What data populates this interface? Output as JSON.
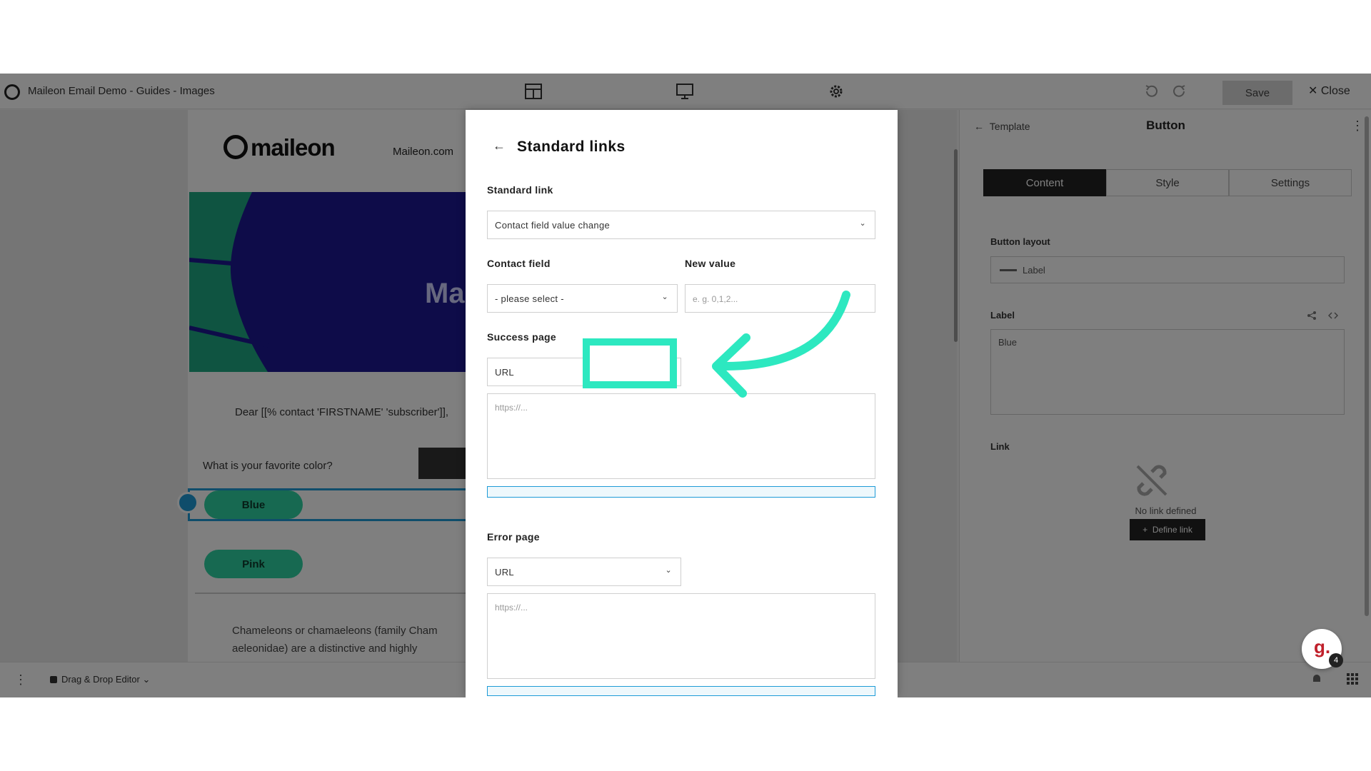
{
  "app": {
    "title": "Maileon Email Demo - Guides - Images",
    "save_label": "Save",
    "close_label": "Close"
  },
  "email_preview": {
    "brand": "maileon",
    "brand_link": "Maileon.com",
    "hero_text": "Mai",
    "greeting": "Dear [[% contact 'FIRSTNAME' 'subscriber']],",
    "question": "What is your favorite color?",
    "buttons": [
      "Blue",
      "Pink"
    ],
    "paragraph": "Chameleons or chamaeleons (family Cham aeleonidae) are a distinctive and highly"
  },
  "inspector": {
    "back_label": "Template",
    "title": "Button",
    "tabs": [
      {
        "label": "Content",
        "active": true
      },
      {
        "label": "Style",
        "active": false
      },
      {
        "label": "Settings",
        "active": false
      }
    ],
    "layout_label": "Button layout",
    "layout_value": "Label",
    "label_label": "Label",
    "label_value": "Blue",
    "link_label": "Link",
    "no_link_text": "No link defined",
    "define_link": "Define link"
  },
  "bottombar": {
    "editor_label": "Drag & Drop Editor",
    "guide_badge_count": "4"
  },
  "modal": {
    "title": "Standard links",
    "standard_link_label": "Standard link",
    "standard_link_value": "Contact field value change",
    "contact_field_label": "Contact field",
    "contact_field_value": "- please select -",
    "new_value_label": "New value",
    "new_value_placeholder": "e. g. 0,1,2...",
    "success_page_label": "Success page",
    "success_type_value": "URL",
    "success_url_placeholder": "https://...",
    "error_page_label": "Error page",
    "error_type_value": "URL",
    "error_url_placeholder": "https://..."
  },
  "colors": {
    "accent_annotation": "#2de8c0",
    "button_green": "#2ed3a2",
    "hero_blue": "#1c1893",
    "selection_blue": "#1e9bd7"
  }
}
